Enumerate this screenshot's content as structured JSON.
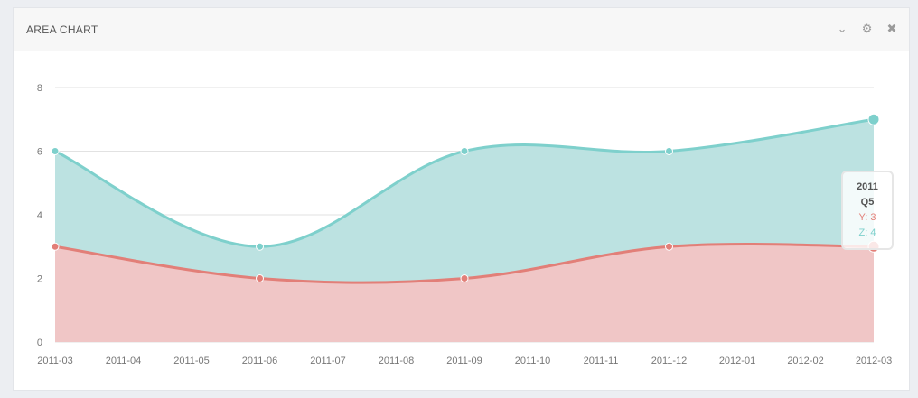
{
  "panel": {
    "title": "AREA CHART",
    "tools": [
      {
        "name": "collapse-icon",
        "glyph": "⌄"
      },
      {
        "name": "gear-icon",
        "glyph": "⚙"
      },
      {
        "name": "close-icon",
        "glyph": "✖"
      }
    ]
  },
  "colors": {
    "z_line": "#7ed0cc",
    "z_fill": "#bce2e1",
    "y_line": "#e27f78",
    "y_fill": "#f0c6c6",
    "grid": "#e2e2e2"
  },
  "tooltip": {
    "header_line1": "2011",
    "header_line2": "Q5",
    "y_text": "Y: 3",
    "z_text": "Z: 4"
  },
  "chart_data": {
    "type": "area",
    "categories": [
      "2011-03",
      "2011-04",
      "2011-05",
      "2011-06",
      "2011-07",
      "2011-08",
      "2011-09",
      "2011-10",
      "2011-11",
      "2011-12",
      "2012-01",
      "2012-02",
      "2012-03"
    ],
    "ylim": [
      0,
      8
    ],
    "yticks": [
      0,
      2,
      4,
      6,
      8
    ],
    "grid": true,
    "points_x_index": [
      0,
      3,
      6,
      9,
      12
    ],
    "series": [
      {
        "name": "Y",
        "values": [
          3,
          2,
          2,
          3,
          3
        ]
      },
      {
        "name": "Z",
        "values": [
          3,
          1,
          4,
          3,
          4
        ],
        "stacked_totals": [
          6,
          3,
          6,
          6,
          7
        ]
      }
    ]
  }
}
